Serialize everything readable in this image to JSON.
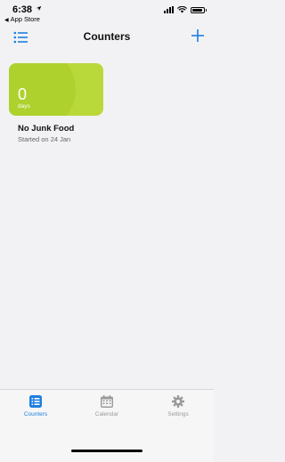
{
  "status_bar": {
    "time": "6:38",
    "back_label": "App Store",
    "back_glyph": "◀",
    "icons": [
      "location-arrow-icon",
      "cellular-signal-icon",
      "wifi-icon",
      "battery-icon"
    ]
  },
  "nav": {
    "title": "Counters",
    "left_icon": "list-icon",
    "right_icon": "plus-icon"
  },
  "counters": [
    {
      "value": "0",
      "unit": "days",
      "name": "No Junk Food",
      "subtitle": "Started on 24 Jan",
      "color": "#b9d93a"
    }
  ],
  "tabs": [
    {
      "label": "Counters",
      "icon": "list-tab-icon",
      "active": true
    },
    {
      "label": "Calendar",
      "icon": "calendar-icon",
      "active": false
    },
    {
      "label": "Settings",
      "icon": "gear-icon",
      "active": false
    }
  ],
  "colors": {
    "accent": "#1f7fe0",
    "inactive_tab": "#9a9a9a",
    "background": "#f2f2f4",
    "card": "#b9d93a"
  }
}
